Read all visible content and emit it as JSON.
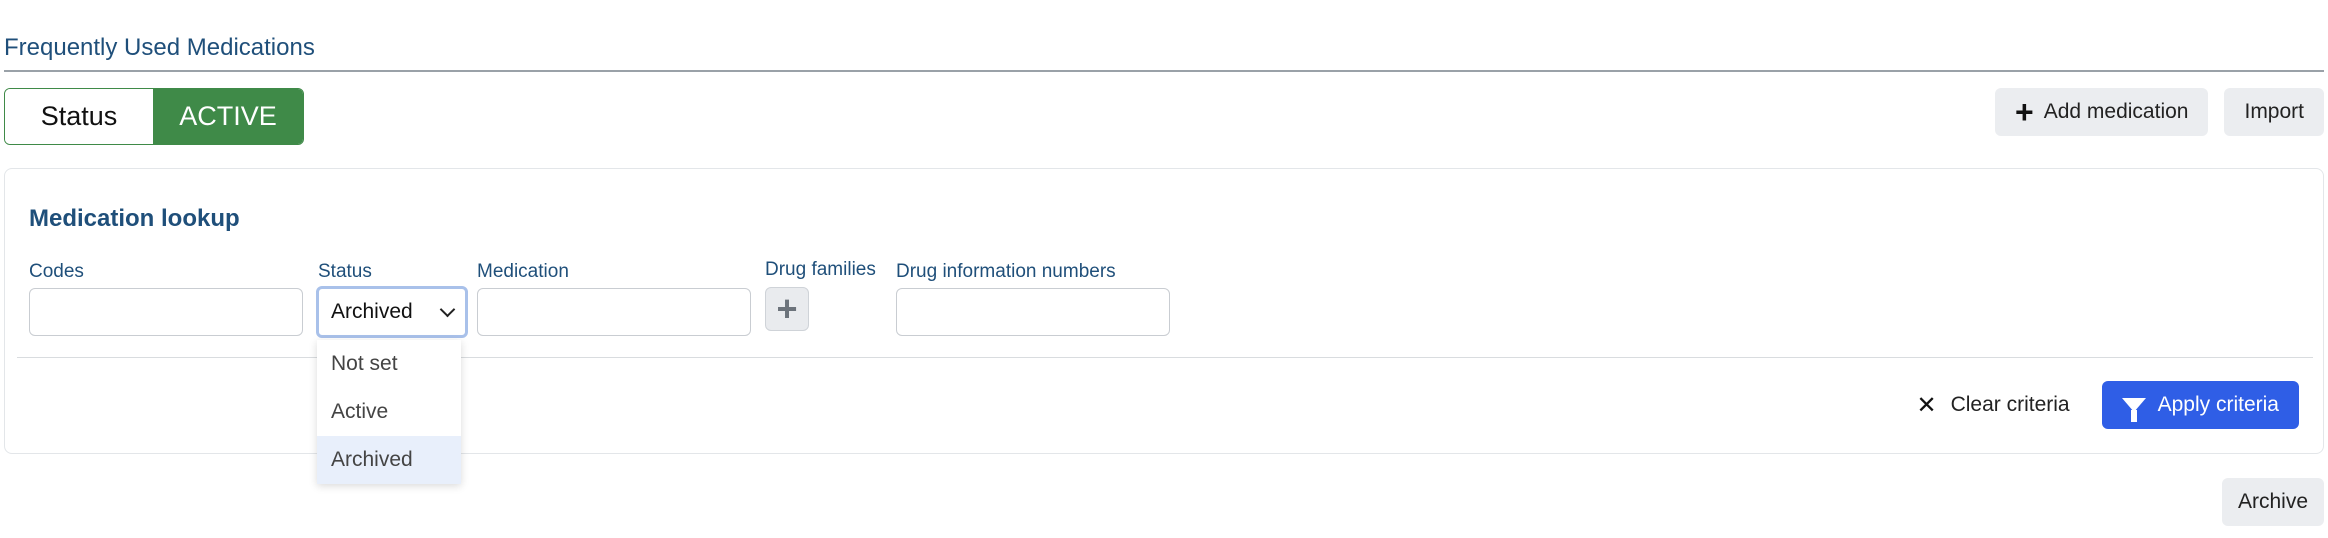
{
  "page": {
    "title": "Frequently Used Medications"
  },
  "status_toggle": {
    "label": "Status",
    "value": "ACTIVE"
  },
  "toolbar": {
    "add_label": "Add medication",
    "import_label": "Import"
  },
  "lookup": {
    "title": "Medication lookup",
    "fields": {
      "codes": {
        "label": "Codes",
        "value": ""
      },
      "status": {
        "label": "Status",
        "value": "Archived"
      },
      "medication": {
        "label": "Medication",
        "value": ""
      },
      "drug_families": {
        "label": "Drug families"
      },
      "drug_info": {
        "label": "Drug information numbers",
        "value": ""
      }
    },
    "status_options": [
      "Not set",
      "Active",
      "Archived"
    ],
    "clear_label": "Clear criteria",
    "apply_label": "Apply criteria"
  },
  "footer": {
    "archive_label": "Archive"
  },
  "colors": {
    "accent": "#2f5ee6",
    "active_green": "#3f8a48",
    "title_blue": "#1f4f7a"
  }
}
